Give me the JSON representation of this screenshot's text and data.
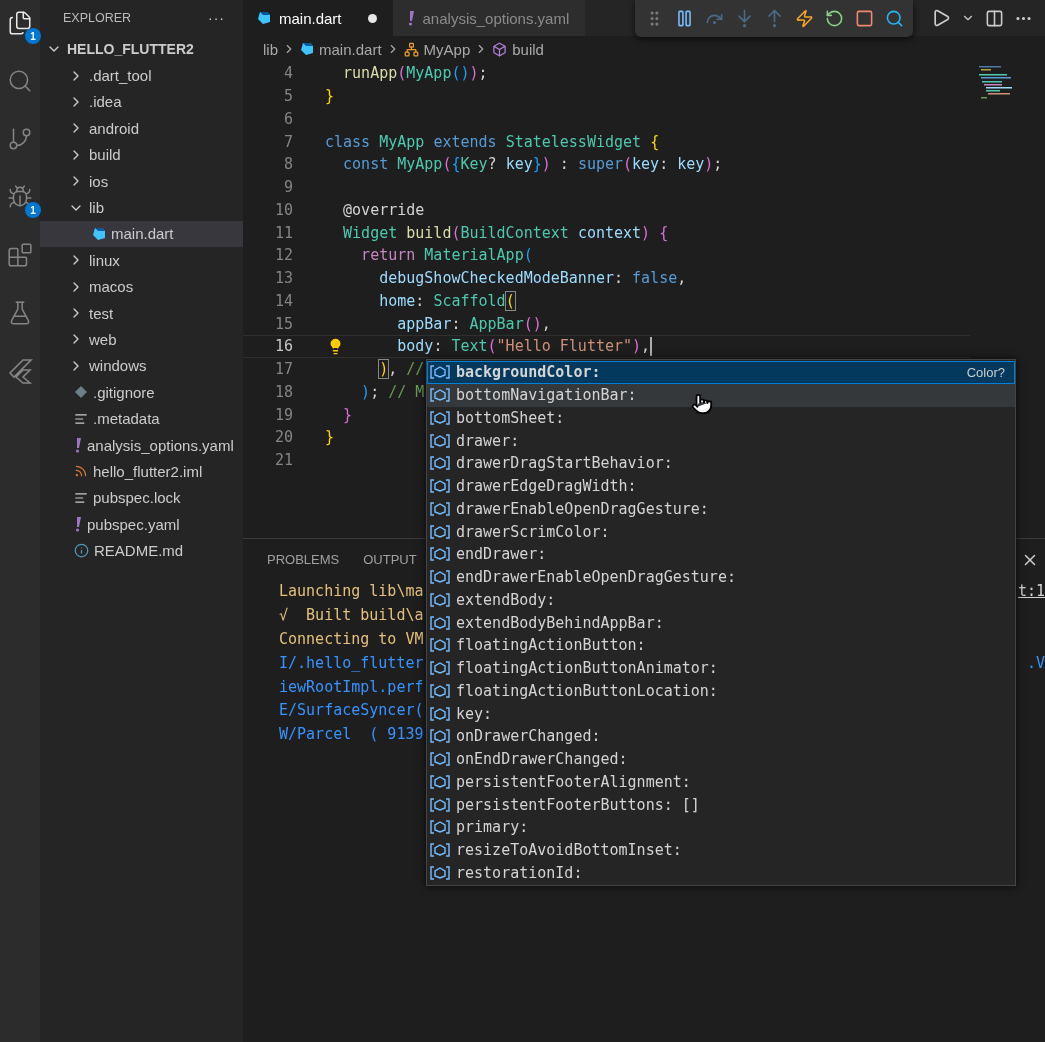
{
  "activity_bar": [
    {
      "kind": "files",
      "badge": "1",
      "selected": true
    },
    {
      "kind": "search",
      "selected": false
    },
    {
      "kind": "source-control",
      "selected": false
    },
    {
      "kind": "run-debug",
      "badge": "1",
      "selected": false
    },
    {
      "kind": "extensions",
      "selected": false
    },
    {
      "kind": "testing",
      "selected": false
    },
    {
      "kind": "flutter",
      "selected": false
    }
  ],
  "sidebar": {
    "title": "EXPLORER",
    "more": "···",
    "project": {
      "label": "HELLO_FLUTTER2",
      "expanded": true
    },
    "items": [
      {
        "label": ".dart_tool",
        "kind": "folder",
        "expanded": false,
        "selected": false
      },
      {
        "label": ".idea",
        "kind": "folder",
        "expanded": false,
        "selected": false
      },
      {
        "label": "android",
        "kind": "folder",
        "expanded": false,
        "selected": false
      },
      {
        "label": "build",
        "kind": "folder",
        "expanded": false,
        "selected": false
      },
      {
        "label": "ios",
        "kind": "folder",
        "expanded": false,
        "selected": false
      },
      {
        "label": "lib",
        "kind": "folder",
        "expanded": true,
        "selected": false,
        "children": [
          {
            "label": "main.dart",
            "kind": "dart",
            "selected": true
          }
        ]
      },
      {
        "label": "linux",
        "kind": "folder",
        "expanded": false,
        "selected": false
      },
      {
        "label": "macos",
        "kind": "folder",
        "expanded": false,
        "selected": false
      },
      {
        "label": "test",
        "kind": "folder",
        "expanded": false,
        "selected": false
      },
      {
        "label": "web",
        "kind": "folder",
        "expanded": false,
        "selected": false
      },
      {
        "label": "windows",
        "kind": "folder",
        "expanded": false,
        "selected": false
      },
      {
        "label": ".gitignore",
        "kind": "git",
        "selected": false
      },
      {
        "label": ".metadata",
        "kind": "text",
        "selected": false
      },
      {
        "label": "analysis_options.yaml",
        "kind": "yaml",
        "selected": false
      },
      {
        "label": "hello_flutter2.iml",
        "kind": "feed",
        "selected": false
      },
      {
        "label": "pubspec.lock",
        "kind": "text",
        "selected": false
      },
      {
        "label": "pubspec.yaml",
        "kind": "yaml",
        "selected": false
      },
      {
        "label": "README.md",
        "kind": "info",
        "selected": false
      }
    ]
  },
  "tabs": [
    {
      "label": "main.dart",
      "kind": "dart",
      "selected": true,
      "modified": true
    },
    {
      "label": "analysis_options.yaml",
      "kind": "yaml",
      "selected": false,
      "modified": false
    }
  ],
  "debug_toolbar": [
    {
      "kind": "grip"
    },
    {
      "kind": "pause"
    },
    {
      "kind": "step-over"
    },
    {
      "kind": "step-into"
    },
    {
      "kind": "step-out"
    },
    {
      "kind": "hot-reload"
    },
    {
      "kind": "restart"
    },
    {
      "kind": "stop"
    },
    {
      "kind": "inspect"
    }
  ],
  "editor_actions": [
    {
      "kind": "run"
    },
    {
      "kind": "dropdown"
    },
    {
      "kind": "split"
    },
    {
      "kind": "more"
    }
  ],
  "breadcrumbs": [
    {
      "label": "lib",
      "kind": "folder"
    },
    {
      "label": "main.dart",
      "kind": "dart"
    },
    {
      "label": "MyApp",
      "kind": "class"
    },
    {
      "label": "build",
      "kind": "method"
    }
  ],
  "code": [
    {
      "number": "4",
      "current": false,
      "tokens": [
        {
          "t": "  runApp",
          "kind": "function"
        },
        {
          "t": "(",
          "kind": "b2"
        },
        {
          "t": "MyApp",
          "kind": "type"
        },
        {
          "t": "()",
          "kind": "b3"
        },
        {
          "t": ")",
          "kind": "b2"
        },
        {
          "t": ";"
        }
      ]
    },
    {
      "number": "5",
      "current": false,
      "tokens": [
        {
          "t": "}",
          "kind": "b1"
        }
      ]
    },
    {
      "number": "6",
      "current": false
    },
    {
      "number": "7",
      "current": false,
      "tokens": [
        {
          "t": "class ",
          "kind": "keyword"
        },
        {
          "t": "MyApp ",
          "kind": "type"
        },
        {
          "t": "extends ",
          "kind": "keyword"
        },
        {
          "t": "StatelessWidget ",
          "kind": "type"
        },
        {
          "t": "{",
          "kind": "b1"
        }
      ]
    },
    {
      "number": "8",
      "current": false,
      "tokens": [
        {
          "t": "  const ",
          "kind": "keyword"
        },
        {
          "t": "MyApp",
          "kind": "type"
        },
        {
          "t": "(",
          "kind": "b2"
        },
        {
          "t": "{",
          "kind": "b3"
        },
        {
          "t": "Key",
          "kind": "type"
        },
        {
          "t": "? "
        },
        {
          "t": "key",
          "kind": "param"
        },
        {
          "t": "}",
          "kind": "b3"
        },
        {
          "t": ")",
          "kind": "b2"
        },
        {
          "t": " : "
        },
        {
          "t": "super",
          "kind": "keyword"
        },
        {
          "t": "(",
          "kind": "b2"
        },
        {
          "t": "key",
          "kind": "param"
        },
        {
          "t": ": "
        },
        {
          "t": "key",
          "kind": "param"
        },
        {
          "t": ")",
          "kind": "b2"
        },
        {
          "t": ";"
        }
      ]
    },
    {
      "number": "9",
      "current": false
    },
    {
      "number": "10",
      "current": false,
      "tokens": [
        {
          "t": "  @override"
        }
      ]
    },
    {
      "number": "11",
      "current": false,
      "tokens": [
        {
          "t": "  Widget ",
          "kind": "type"
        },
        {
          "t": "build",
          "kind": "function"
        },
        {
          "t": "(",
          "kind": "b2"
        },
        {
          "t": "BuildContext ",
          "kind": "type"
        },
        {
          "t": "context",
          "kind": "param"
        },
        {
          "t": ")",
          "kind": "b2"
        },
        {
          "t": " {",
          "kind": "b2"
        }
      ]
    },
    {
      "number": "12",
      "current": false,
      "tokens": [
        {
          "t": "    return ",
          "kind": "control"
        },
        {
          "t": "MaterialApp",
          "kind": "type"
        },
        {
          "t": "(",
          "kind": "b3"
        }
      ]
    },
    {
      "number": "13",
      "current": false,
      "tokens": [
        {
          "t": "      debugShowCheckedModeBanner",
          "kind": "param"
        },
        {
          "t": ": "
        },
        {
          "t": "false",
          "kind": "keyword"
        },
        {
          "t": ","
        }
      ]
    },
    {
      "number": "14",
      "current": false,
      "tokens": [
        {
          "t": "      home",
          "kind": "param"
        },
        {
          "t": ": "
        },
        {
          "t": "Scaffold",
          "kind": "type"
        },
        {
          "t": "(",
          "kind": "b1",
          "boxed": true
        }
      ]
    },
    {
      "number": "15",
      "current": false,
      "tokens": [
        {
          "t": "        appBar",
          "kind": "param"
        },
        {
          "t": ": "
        },
        {
          "t": "AppBar",
          "kind": "type"
        },
        {
          "t": "()",
          "kind": "b2"
        },
        {
          "t": ","
        }
      ]
    },
    {
      "number": "16",
      "current": true,
      "tokens": [
        {
          "t": "        body",
          "kind": "param"
        },
        {
          "t": ": "
        },
        {
          "t": "Text",
          "kind": "type"
        },
        {
          "t": "(",
          "kind": "b2"
        },
        {
          "t": "\"Hello Flutter\"",
          "kind": "string"
        },
        {
          "t": ")",
          "kind": "b2"
        },
        {
          "t": ","
        }
      ]
    },
    {
      "number": "17",
      "current": false,
      "tokens": [
        {
          "t": "      )",
          "kind": "b1",
          "boxed": true
        },
        {
          "t": ", "
        },
        {
          "t": "//",
          "kind": "comment"
        }
      ]
    },
    {
      "number": "18",
      "current": false,
      "tokens": [
        {
          "t": "    )",
          "kind": "b3"
        },
        {
          "t": "; "
        },
        {
          "t": "// M",
          "kind": "comment"
        }
      ]
    },
    {
      "number": "19",
      "current": false,
      "tokens": [
        {
          "t": "  }",
          "kind": "b2"
        }
      ]
    },
    {
      "number": "20",
      "current": false,
      "tokens": [
        {
          "t": "}",
          "kind": "b1"
        }
      ]
    },
    {
      "number": "21",
      "current": false
    }
  ],
  "panel": {
    "tabs": [
      {
        "label": "PROBLEMS",
        "selected": false
      },
      {
        "label": "OUTPUT",
        "selected": false
      }
    ],
    "lines": [
      {
        "text": "Launching lib\\ma",
        "kind": "info",
        "tail": "t:1"
      },
      {
        "text": "√  Built build\\a",
        "kind": "info"
      },
      {
        "text": "Connecting to VM",
        "kind": "info"
      },
      {
        "text": "I/.hello_flutter",
        "kind": "log",
        "tail": ".V"
      },
      {
        "text": "iewRootImpl.perf",
        "kind": "log"
      },
      {
        "text": "E/SurfaceSyncer(",
        "kind": "log"
      },
      {
        "text": "W/Parcel  ( 9139",
        "kind": "log"
      }
    ]
  },
  "suggestions": [
    {
      "label": "backgroundColor:",
      "detail": "Color?",
      "selected": true,
      "hovered": false
    },
    {
      "label": "bottomNavigationBar:",
      "selected": false,
      "hovered": true
    },
    {
      "label": "bottomSheet:",
      "selected": false,
      "hovered": false
    },
    {
      "label": "drawer:",
      "selected": false,
      "hovered": false
    },
    {
      "label": "drawerDragStartBehavior:",
      "selected": false,
      "hovered": false
    },
    {
      "label": "drawerEdgeDragWidth:",
      "selected": false,
      "hovered": false
    },
    {
      "label": "drawerEnableOpenDragGesture:",
      "selected": false,
      "hovered": false
    },
    {
      "label": "drawerScrimColor:",
      "selected": false,
      "hovered": false
    },
    {
      "label": "endDrawer:",
      "selected": false,
      "hovered": false
    },
    {
      "label": "endDrawerEnableOpenDragGesture:",
      "selected": false,
      "hovered": false
    },
    {
      "label": "extendBody:",
      "selected": false,
      "hovered": false
    },
    {
      "label": "extendBodyBehindAppBar:",
      "selected": false,
      "hovered": false
    },
    {
      "label": "floatingActionButton:",
      "selected": false,
      "hovered": false
    },
    {
      "label": "floatingActionButtonAnimator:",
      "selected": false,
      "hovered": false
    },
    {
      "label": "floatingActionButtonLocation:",
      "selected": false,
      "hovered": false
    },
    {
      "label": "key:",
      "selected": false,
      "hovered": false
    },
    {
      "label": "onDrawerChanged:",
      "selected": false,
      "hovered": false
    },
    {
      "label": "onEndDrawerChanged:",
      "selected": false,
      "hovered": false
    },
    {
      "label": "persistentFooterAlignment:",
      "selected": false,
      "hovered": false
    },
    {
      "label": "persistentFooterButtons: []",
      "selected": false,
      "hovered": false
    },
    {
      "label": "primary:",
      "selected": false,
      "hovered": false
    },
    {
      "label": "resizeToAvoidBottomInset:",
      "selected": false,
      "hovered": false
    },
    {
      "label": "restorationId:",
      "selected": false,
      "hovered": false
    }
  ]
}
